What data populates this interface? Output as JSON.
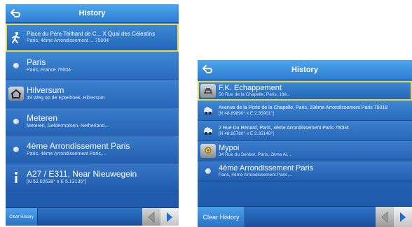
{
  "left": {
    "title": "History",
    "items": [
      {
        "title": "Place du Père Teilhard de C... X Quai des Célestins",
        "subtitle": "Paris, 4ème Arrondissement ... 75004",
        "icon": "walking-person-icon",
        "selected": true
      },
      {
        "title": "Paris",
        "subtitle": "Paris, France 75004",
        "icon": "dot-icon"
      },
      {
        "title": "Hilversum",
        "subtitle": "49 Weg op de Eptelhoek, Hilversum",
        "icon": "home-icon"
      },
      {
        "title": "Meteren",
        "subtitle": "Meteren, Geldermalsen, Netherland...",
        "icon": "dot-icon"
      },
      {
        "title": "4ème Arrondissement Paris",
        "subtitle": "Paris, 4ème Arrondissement Paris,...",
        "icon": "dot-icon"
      },
      {
        "title": "A27 / E311, Near Nieuwegein",
        "subtitle": "[N 52.02638° x E 5.13135°]",
        "icon": "info-icon"
      }
    ],
    "clear_label": "Clear History"
  },
  "right": {
    "title": "History",
    "items": [
      {
        "title": "F.K. Echappement",
        "subtitle": "56 Rue de la Chapelle, Paris, 18è...",
        "icon": "garage-icon",
        "selected": true
      },
      {
        "title": "Avenue de la Porte de la Chapelle, Paris, 18ème Arrondissement Paris 75018",
        "subtitle": "[N 48.89890° x E 2.35901°]",
        "icon": "car-icon",
        "small": true
      },
      {
        "title": "2 Rue Du Renard, Paris, 4ème Arrondissement Paris 75004",
        "subtitle": "[N 48.85780° x E 2.35148°]",
        "icon": "car-icon",
        "small": true
      },
      {
        "title": "Mypoi",
        "subtitle": "34 Rue du Sentier, Paris, 2ème Ar...",
        "icon": "poi-icon"
      },
      {
        "title": "4ème Arrondissement Paris",
        "subtitle": "Paris, 4ème Arrondissement Paris,...",
        "icon": "dot-icon"
      }
    ],
    "clear_label": "Clear History"
  },
  "colors": {
    "accent": "#2c6fc2",
    "selected_outline": "#e8d84a",
    "arrow": "#1e6fd0"
  }
}
